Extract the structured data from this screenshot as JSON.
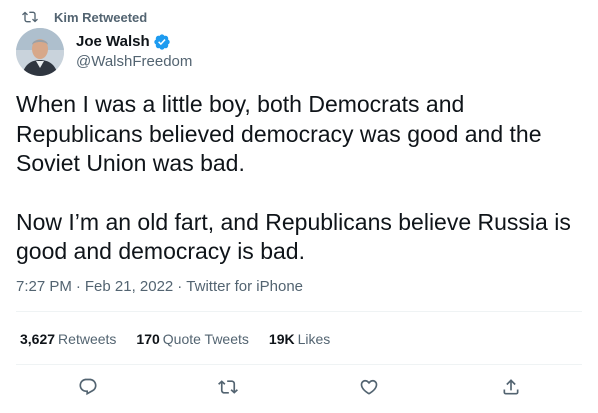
{
  "colors": {
    "primary_text": "#0f1419",
    "secondary_text": "#536471",
    "verified": "#1d9bf0",
    "divider": "#eff3f4"
  },
  "retweet_context": {
    "icon": "retweet-icon",
    "label": "Kim Retweeted"
  },
  "author": {
    "avatar": "avatar",
    "name": "Joe Walsh",
    "verified_icon": "verified-badge-icon",
    "handle": "@WalshFreedom"
  },
  "tweet": {
    "paragraphs": [
      "When I was a little boy, both Democrats and Republicans believed democracy was good and the Soviet Union was bad.",
      "Now I’m an old fart, and Republicans believe Russia is good and democracy is bad."
    ],
    "time": "7:27 PM",
    "separator": "·",
    "date": "Feb 21, 2022",
    "source": "Twitter for iPhone"
  },
  "stats": {
    "retweets_count": "3,627",
    "retweets_label": "Retweets",
    "quote_tweets_count": "170",
    "quote_tweets_label": "Quote Tweets",
    "likes_count": "19K",
    "likes_label": "Likes"
  },
  "actions": {
    "reply_icon": "reply-icon",
    "retweet_icon": "retweet-icon",
    "like_icon": "heart-icon",
    "share_icon": "share-icon"
  }
}
